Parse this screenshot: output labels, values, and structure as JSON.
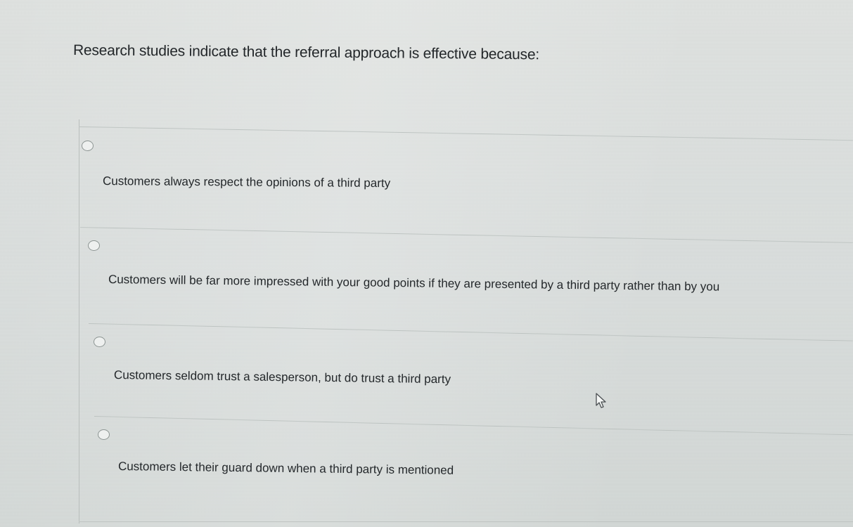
{
  "question": {
    "text": "Research studies indicate that the referral approach is effective because:"
  },
  "options": [
    {
      "label": "Customers always respect the opinions of a third party",
      "selected": false
    },
    {
      "label": "Customers will be far more impressed with your good points if they are presented by a third party rather than by you",
      "selected": false
    },
    {
      "label": "Customers seldom trust a salesperson, but do trust a third party",
      "selected": false
    },
    {
      "label": "Customers let their guard down when a third party is mentioned",
      "selected": false
    }
  ],
  "cursor": {
    "icon": "pointer-arrow-icon"
  }
}
